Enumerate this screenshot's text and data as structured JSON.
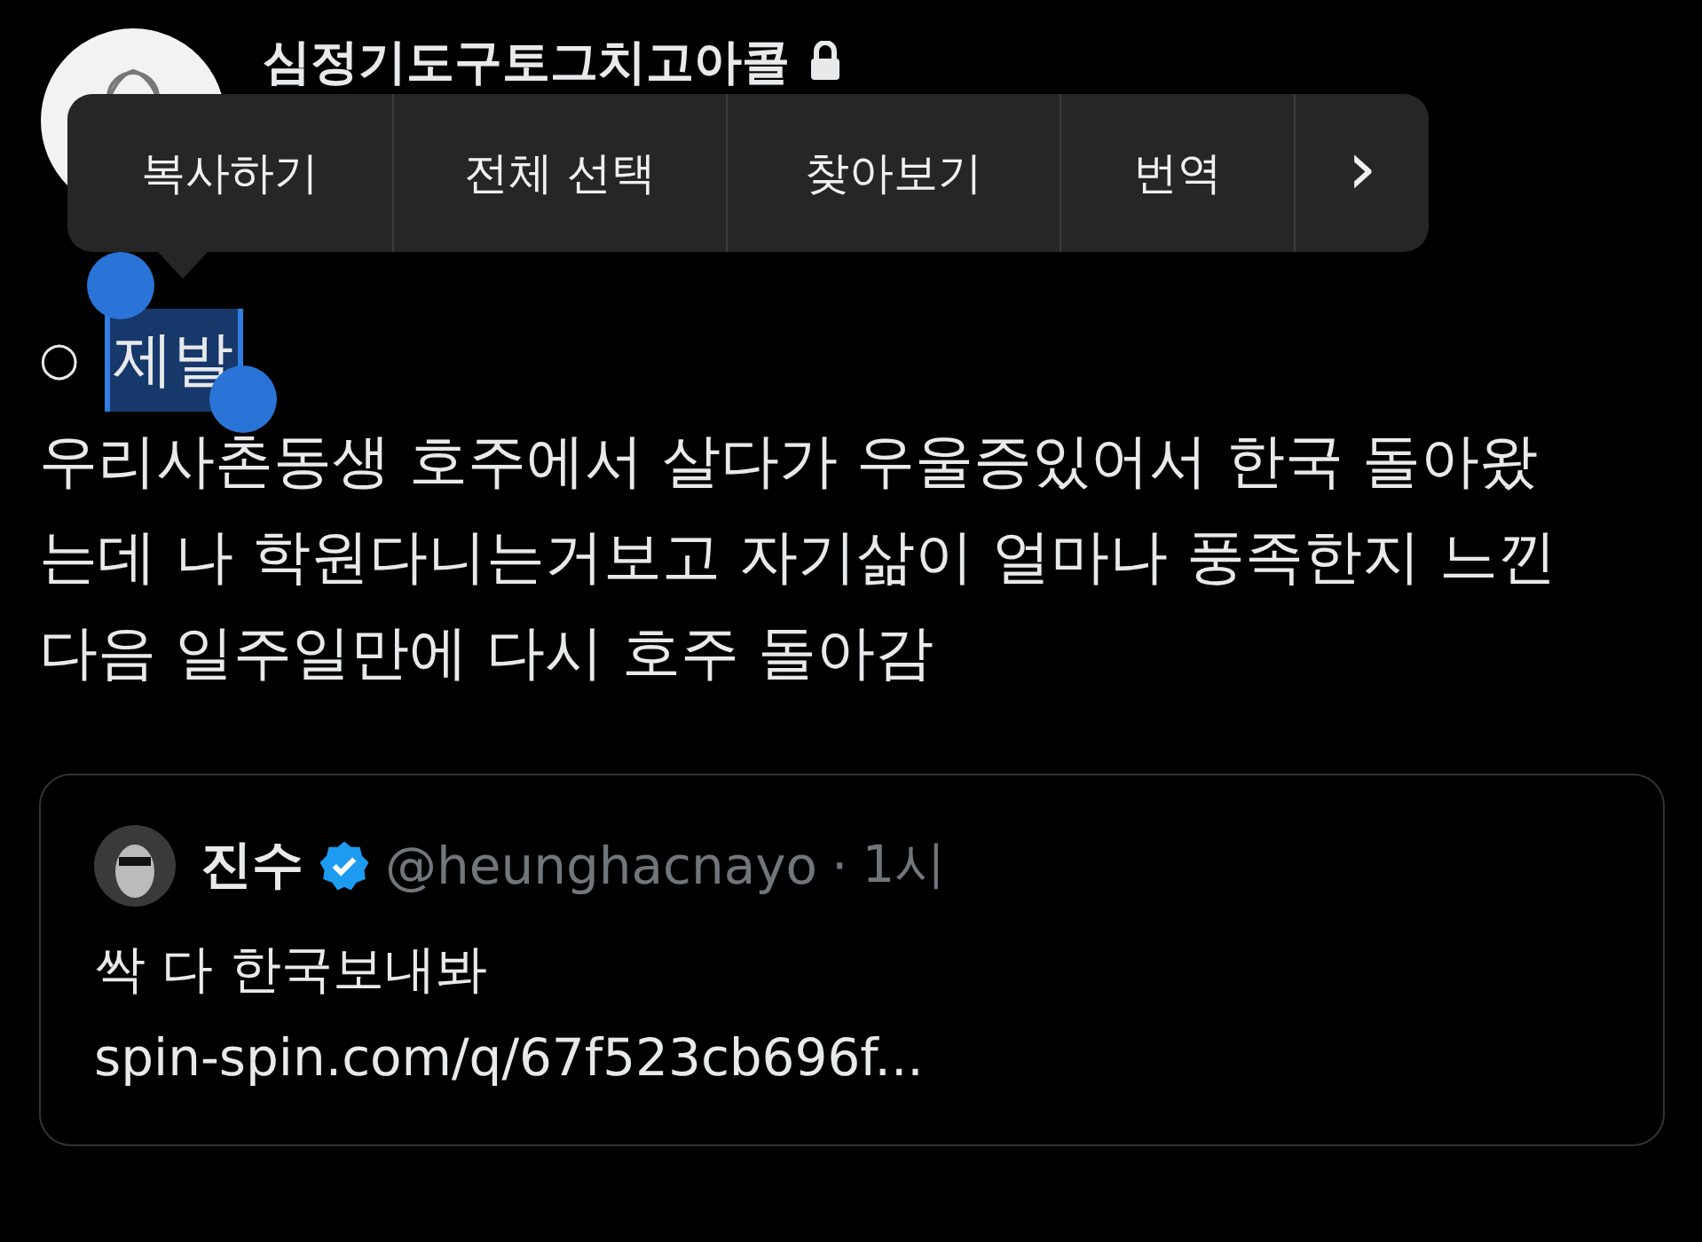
{
  "author": {
    "name": "심정기도구토그치고아콜",
    "locked": true
  },
  "context_menu": {
    "items": [
      {
        "label": "복사하기"
      },
      {
        "label": "전체 선택"
      },
      {
        "label": "찾아보기"
      },
      {
        "label": "번역"
      }
    ],
    "more": "›"
  },
  "bullet": {
    "mark": "○",
    "text": "제발",
    "selected": true
  },
  "body_lines": [
    "우리사촌동생 호주에서 살다가 우울증있어서 한국 돌아왔",
    "는데 나 학원다니는거보고 자기삶이 얼마나 풍족한지 느낀",
    "다음 일주일만에 다시 호주 돌아감"
  ],
  "quote": {
    "name": "진수",
    "verified": true,
    "handle": "@heunghacnayo",
    "separator": "·",
    "time": "1시",
    "text": "싹 다 한국보내봐",
    "link": "spin-spin.com/q/67f523cb696f..."
  }
}
